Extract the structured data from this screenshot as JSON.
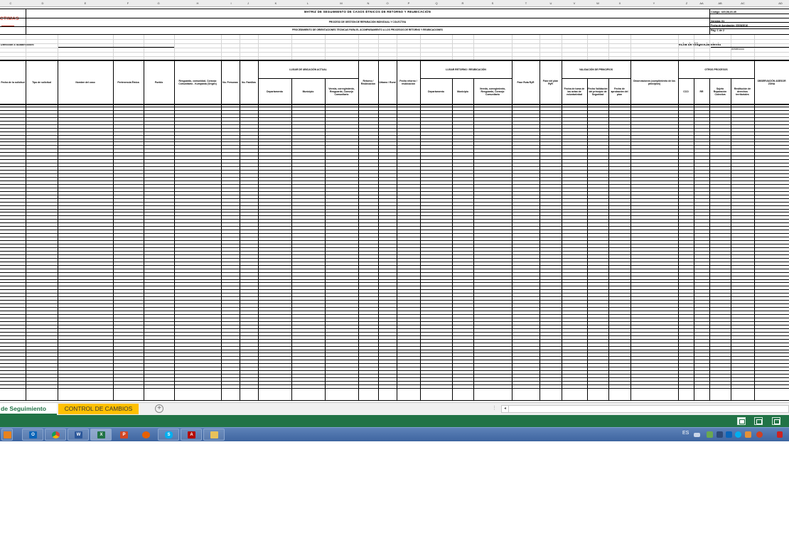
{
  "columns": [
    "C",
    "D",
    "E",
    "F",
    "G",
    "H",
    "I",
    "J",
    "K",
    "L",
    "M",
    "N",
    "O",
    "P",
    "Q",
    "R",
    "S",
    "T",
    "U",
    "V",
    "W",
    "X",
    "Y",
    "Z",
    "AA",
    "AB",
    "AC",
    "AD"
  ],
  "header": {
    "title": "MATRIZ DE SEGUIMIENTO DE CASOS ÉTNICOS DE RETORNO Y REUBICACIÓN",
    "subtitle": "PROCESO DE GESTIÓN DE REPARACIÓN INDIVIDUAL Y COLECTIVA",
    "procedure": "PROCEDIMIENTO DE ORIENTACIONES TÉCNICAS PARA EL ACOMPAÑAMIENTO A LOS PROCESOS DE RETORNO Y REUBICACIONES",
    "logo_text": "CTIMAS",
    "code": "Código: 420,08,15-45",
    "version": "Versión: 01",
    "approval": "Fecha de Aprobación: 05/08/2016",
    "page": "Pág: 1 de 2"
  },
  "meta": {
    "direccion_label": "Dirección o Subdirección:",
    "fecha_label": "echa de diligenciamiento",
    "fecha_format": "DD/MM/AAAA"
  },
  "column_headers": {
    "fecha_solicitud": "Fecha de la solicitud",
    "tipo_solicitud": "Tipo de solicitud",
    "nombre_caso": "Nombre del caso",
    "pertenencia": "Pertenencia Étnica",
    "pueblo": "Pueblo",
    "resguardo": "Resguardo, comunidad, Consejo Comunitario - Kumpania (Origen)",
    "no_personas": "No. Personas",
    "no_familias": "No. Familias",
    "lugar_actual": "LUGAR DE UBICACIÓN ACTUAL",
    "departamento": "Departamento",
    "municipio": "Municipio",
    "vereda": "Vereda, corregimiento, Resguardo, Consejo Comunitario",
    "retorno_reubicacion": "Retorno / Reubicación",
    "urbano_rural": "Urbano / Rural",
    "fecha_retorno": "Fecha retorno / reubicación",
    "lugar_retorno": "LUGAR RETORNO / REUBICACIÓN",
    "departamento2": "Departamento",
    "municipio2": "Municipio",
    "vereda2": "Vereda, corregimiento, Resguardo, Consejo Comunitario",
    "fase_ruta": "Fase Ruta RyR",
    "fase_plan": "Fase del plan RyR",
    "validacion": "VALIDACIÓN DE PRINCIPIOS",
    "fecha_actas": "Fecha de toma de las actas de voluntariedad",
    "fecha_validacion": "Fecha Validación del principio de Seguridad",
    "fecha_aprobacion": "Fecha de aprobación del plan",
    "observaciones": "Observaciones (cumplimiento de los principios)",
    "otros_procesos": "OTROS PROCESOS",
    "cco": "CCO",
    "rr": "RR",
    "sujeto": "Sujeto Reparación Colectiva",
    "restitucion": "Restitución de derechos territoriales",
    "observacion_asesor": "OBSERVACIÓN ASESOR ZONA"
  },
  "sheet_tabs": {
    "active": "de Seguimiento",
    "second": "CONTROL DE CAMBIOS",
    "add": "+"
  },
  "taskbar": {
    "language": "ES",
    "apps": [
      "media",
      "outlook",
      "chrome",
      "word",
      "excel",
      "powerpoint",
      "firefox",
      "skype",
      "acrobat",
      "folder"
    ]
  },
  "colors": {
    "excel_green": "#217346",
    "tab_accent": "#ffc000",
    "logo_red": "#c0392b",
    "taskbar": "#4a70a8"
  }
}
